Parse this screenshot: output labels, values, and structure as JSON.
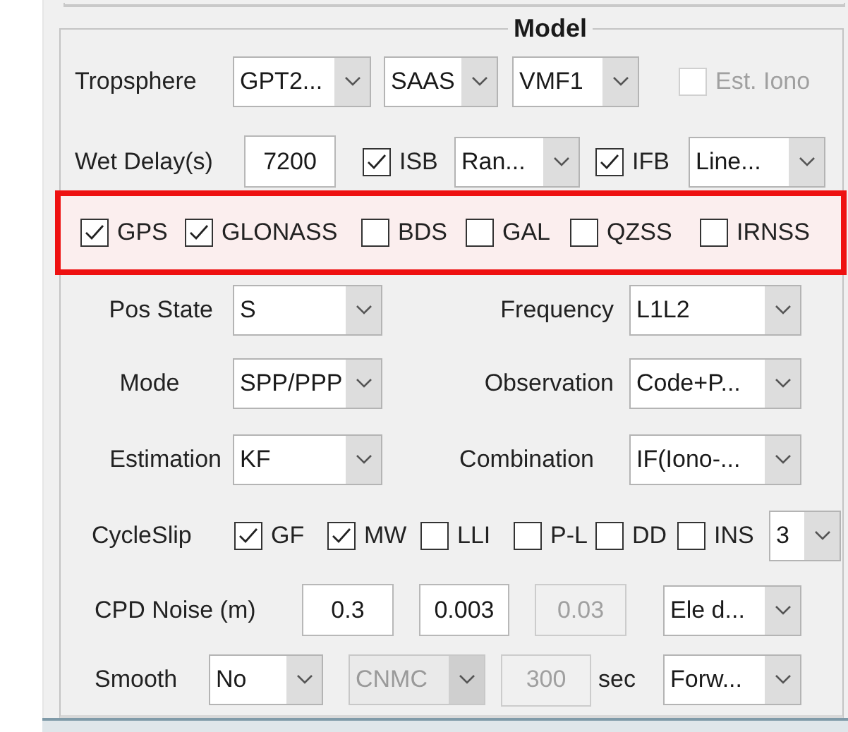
{
  "group": {
    "title": "Model"
  },
  "rows": [
    {
      "items": [
        {
          "kind": "label",
          "text": "Tropsphere"
        },
        {
          "kind": "combo",
          "value": "GPT2...",
          "disabled": false
        },
        {
          "kind": "combo",
          "value": "SAAS",
          "disabled": false
        },
        {
          "kind": "combo",
          "value": "VMF1",
          "disabled": false
        },
        {
          "kind": "check",
          "text": "Est. Iono",
          "checked": false,
          "disabled": true
        }
      ]
    },
    {
      "items": [
        {
          "kind": "label",
          "text": "Wet Delay(s)"
        },
        {
          "kind": "input",
          "value": "7200",
          "disabled": false
        },
        {
          "kind": "check",
          "text": "ISB",
          "checked": true,
          "disabled": false
        },
        {
          "kind": "combo",
          "value": "Ran...",
          "disabled": false
        },
        {
          "kind": "check",
          "text": "IFB",
          "checked": true,
          "disabled": false
        },
        {
          "kind": "combo",
          "value": "Line...",
          "disabled": false
        }
      ]
    },
    {
      "highlighted": true,
      "items": [
        {
          "kind": "check",
          "text": "GPS",
          "checked": true,
          "disabled": false
        },
        {
          "kind": "check",
          "text": "GLONASS",
          "checked": true,
          "disabled": false
        },
        {
          "kind": "check",
          "text": "BDS",
          "checked": false,
          "disabled": false
        },
        {
          "kind": "check",
          "text": "GAL",
          "checked": false,
          "disabled": false
        },
        {
          "kind": "check",
          "text": "QZSS",
          "checked": false,
          "disabled": false
        },
        {
          "kind": "check",
          "text": "IRNSS",
          "checked": false,
          "disabled": false
        }
      ]
    },
    {
      "items": [
        {
          "kind": "label",
          "text": "Pos State"
        },
        {
          "kind": "combo",
          "value": "S",
          "disabled": false
        },
        {
          "kind": "label",
          "text": "Frequency"
        },
        {
          "kind": "combo",
          "value": "L1L2",
          "disabled": false
        }
      ]
    },
    {
      "items": [
        {
          "kind": "label",
          "text": "Mode"
        },
        {
          "kind": "combo",
          "value": "SPP/PPP",
          "disabled": false
        },
        {
          "kind": "label",
          "text": "Observation"
        },
        {
          "kind": "combo",
          "value": "Code+P...",
          "disabled": false
        }
      ]
    },
    {
      "items": [
        {
          "kind": "label",
          "text": "Estimation"
        },
        {
          "kind": "combo",
          "value": "KF",
          "disabled": false
        },
        {
          "kind": "label",
          "text": "Combination"
        },
        {
          "kind": "combo",
          "value": "IF(Iono-...",
          "disabled": false
        }
      ]
    },
    {
      "items": [
        {
          "kind": "label",
          "text": "CycleSlip"
        },
        {
          "kind": "check",
          "text": "GF",
          "checked": true,
          "disabled": false
        },
        {
          "kind": "check",
          "text": "MW",
          "checked": true,
          "disabled": false
        },
        {
          "kind": "check",
          "text": "LLI",
          "checked": false,
          "disabled": false
        },
        {
          "kind": "check",
          "text": "P-L",
          "checked": false,
          "disabled": false
        },
        {
          "kind": "check",
          "text": "DD",
          "checked": false,
          "disabled": false
        },
        {
          "kind": "check",
          "text": "INS",
          "checked": false,
          "disabled": false
        },
        {
          "kind": "combo",
          "value": "3",
          "disabled": false
        }
      ]
    },
    {
      "items": [
        {
          "kind": "label",
          "text": "CPD Noise (m)"
        },
        {
          "kind": "input",
          "value": "0.3",
          "disabled": false
        },
        {
          "kind": "input",
          "value": "0.003",
          "disabled": false
        },
        {
          "kind": "input",
          "value": "0.03",
          "disabled": true
        },
        {
          "kind": "combo",
          "value": "Ele d...",
          "disabled": false
        }
      ]
    },
    {
      "items": [
        {
          "kind": "label",
          "text": "Smooth"
        },
        {
          "kind": "combo",
          "value": "No",
          "disabled": false
        },
        {
          "kind": "combo",
          "value": "CNMC",
          "disabled": true
        },
        {
          "kind": "input",
          "value": "300",
          "disabled": true
        },
        {
          "kind": "label",
          "text": "sec"
        },
        {
          "kind": "combo",
          "value": "Forw...",
          "disabled": false
        }
      ]
    }
  ]
}
